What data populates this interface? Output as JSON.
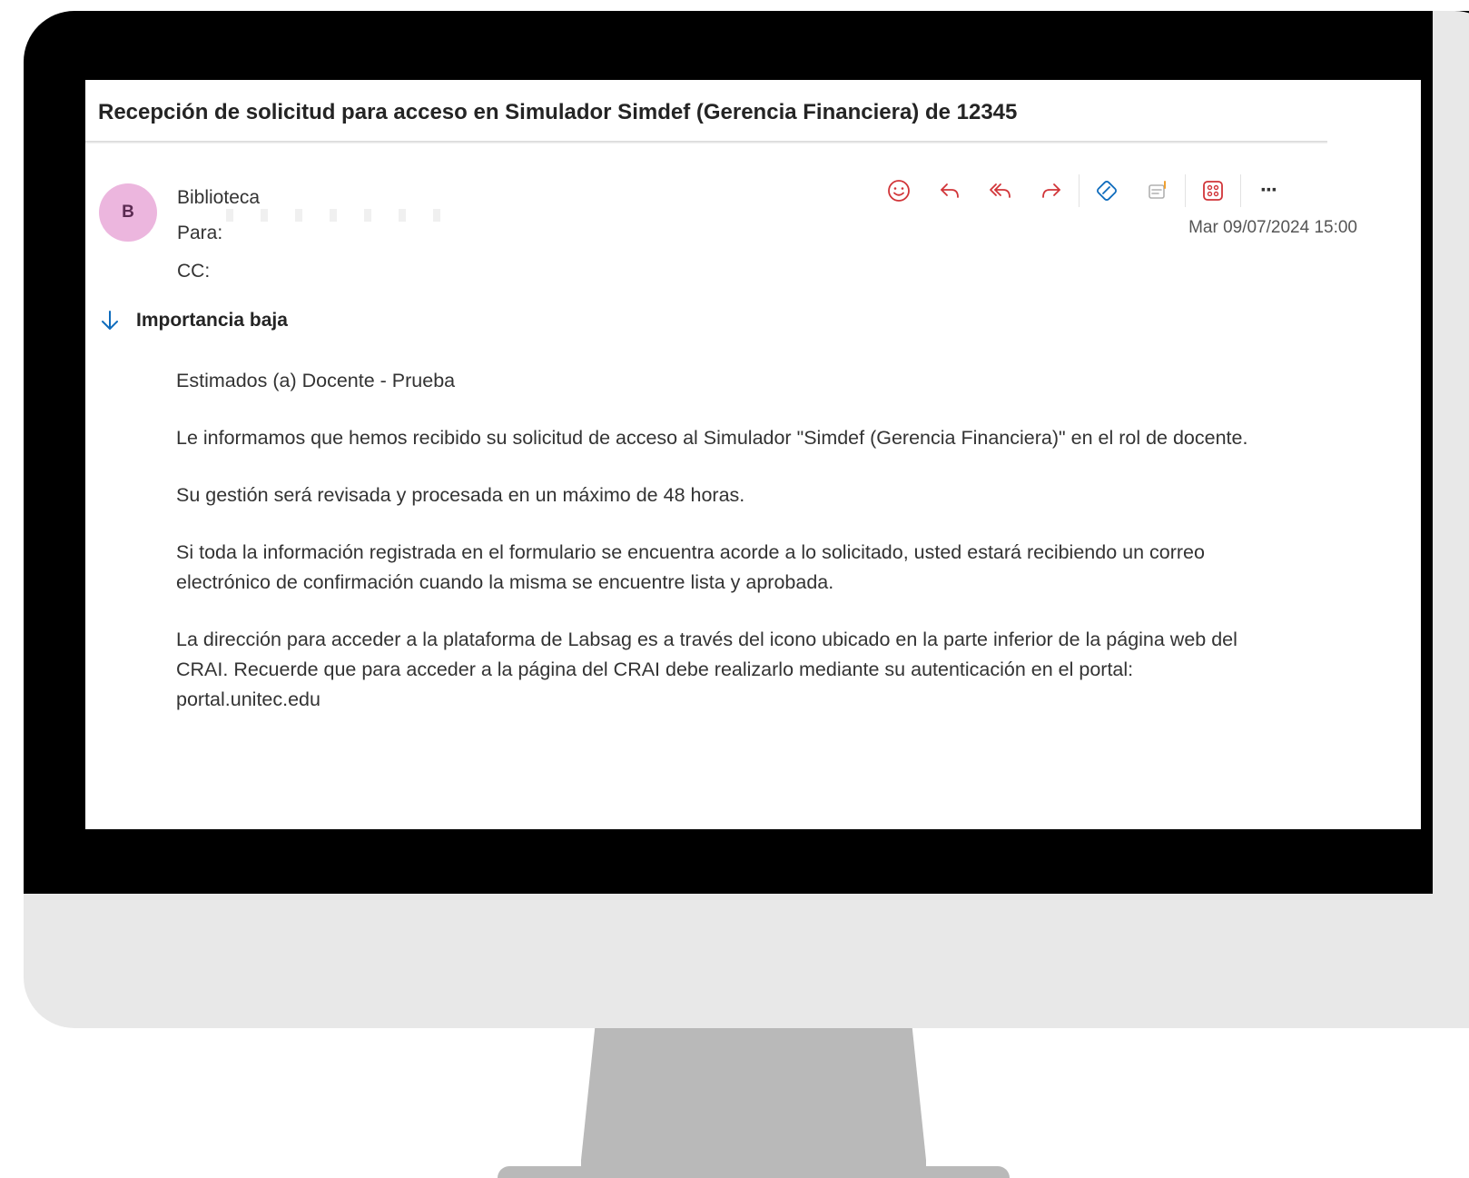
{
  "email": {
    "subject": "Recepción de solicitud para acceso en Simulador Simdef (Gerencia Financiera) de 12345",
    "avatar_initial": "B",
    "sender": "Biblioteca",
    "to_label": "Para:",
    "cc_label": "CC:",
    "date": "Mar 09/07/2024 15:00",
    "importance": "Importancia baja",
    "body": {
      "greeting": "Estimados (a) Docente - Prueba",
      "p1": "Le informamos que hemos recibido su solicitud de acceso al Simulador  \"Simdef (Gerencia Financiera)\" en el rol de docente.",
      "p2": "Su gestión será revisada y procesada en un máximo de 48 horas.",
      "p3": "Si toda la información registrada en el formulario se encuentra acorde a lo solicitado, usted estará recibiendo un correo electrónico de confirmación cuando la misma se encuentre lista y aprobada.",
      "p4": "La dirección para acceder a la plataforma de Labsag es a través del icono ubicado en la parte inferior de la página web del CRAI. Recuerde que para acceder a la página del CRAI debe realizarlo mediante su autenticación en el portal:",
      "link": "portal.unitec.edu"
    }
  },
  "toolbar_icons": [
    "emoji-icon",
    "reply-icon",
    "reply-all-icon",
    "forward-icon",
    "loop-icon",
    "notes-icon",
    "apps-icon",
    "more-icon"
  ],
  "more_label": "···",
  "colors": {
    "accent": "#0f6cbd",
    "icon_red": "#d13438",
    "avatar_bg": "#ecb6de"
  }
}
